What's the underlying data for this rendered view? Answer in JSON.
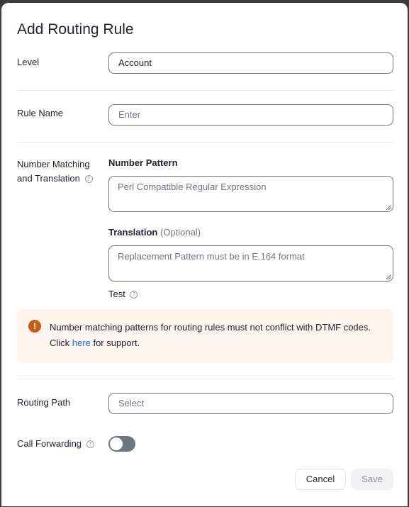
{
  "dialog": {
    "title": "Add Routing Rule"
  },
  "level": {
    "label": "Level",
    "value": "Account"
  },
  "rule_name": {
    "label": "Rule Name",
    "placeholder": "Enter"
  },
  "number_matching": {
    "label_line1": "Number Matching",
    "label_line2": "and Translation",
    "help_icon": "question-circle-icon",
    "number_pattern_label": "Number Pattern",
    "number_pattern_placeholder": "Perl Compatible Regular Expression",
    "translation_label": "Translation",
    "translation_optional": "(Optional)",
    "translation_placeholder": "Replacement Pattern must be in E.164 format",
    "test_label": "Test"
  },
  "alert": {
    "icon": "exclamation-circle-icon",
    "color": "#c75d17",
    "line1": "Number matching patterns for routing rules must not conflict with DTMF codes.",
    "line2_prefix": "Click",
    "link_text": "here",
    "line2_suffix": "for support."
  },
  "routing_path": {
    "label": "Routing Path",
    "placeholder": "Select"
  },
  "call_forwarding": {
    "label": "Call Forwarding",
    "enabled": false
  },
  "footer": {
    "cancel_label": "Cancel",
    "save_label": "Save"
  },
  "colors": {
    "accent_link": "#0e72ed",
    "alert_background": "#fdf4ed",
    "toggle_off": "#6e7680"
  }
}
